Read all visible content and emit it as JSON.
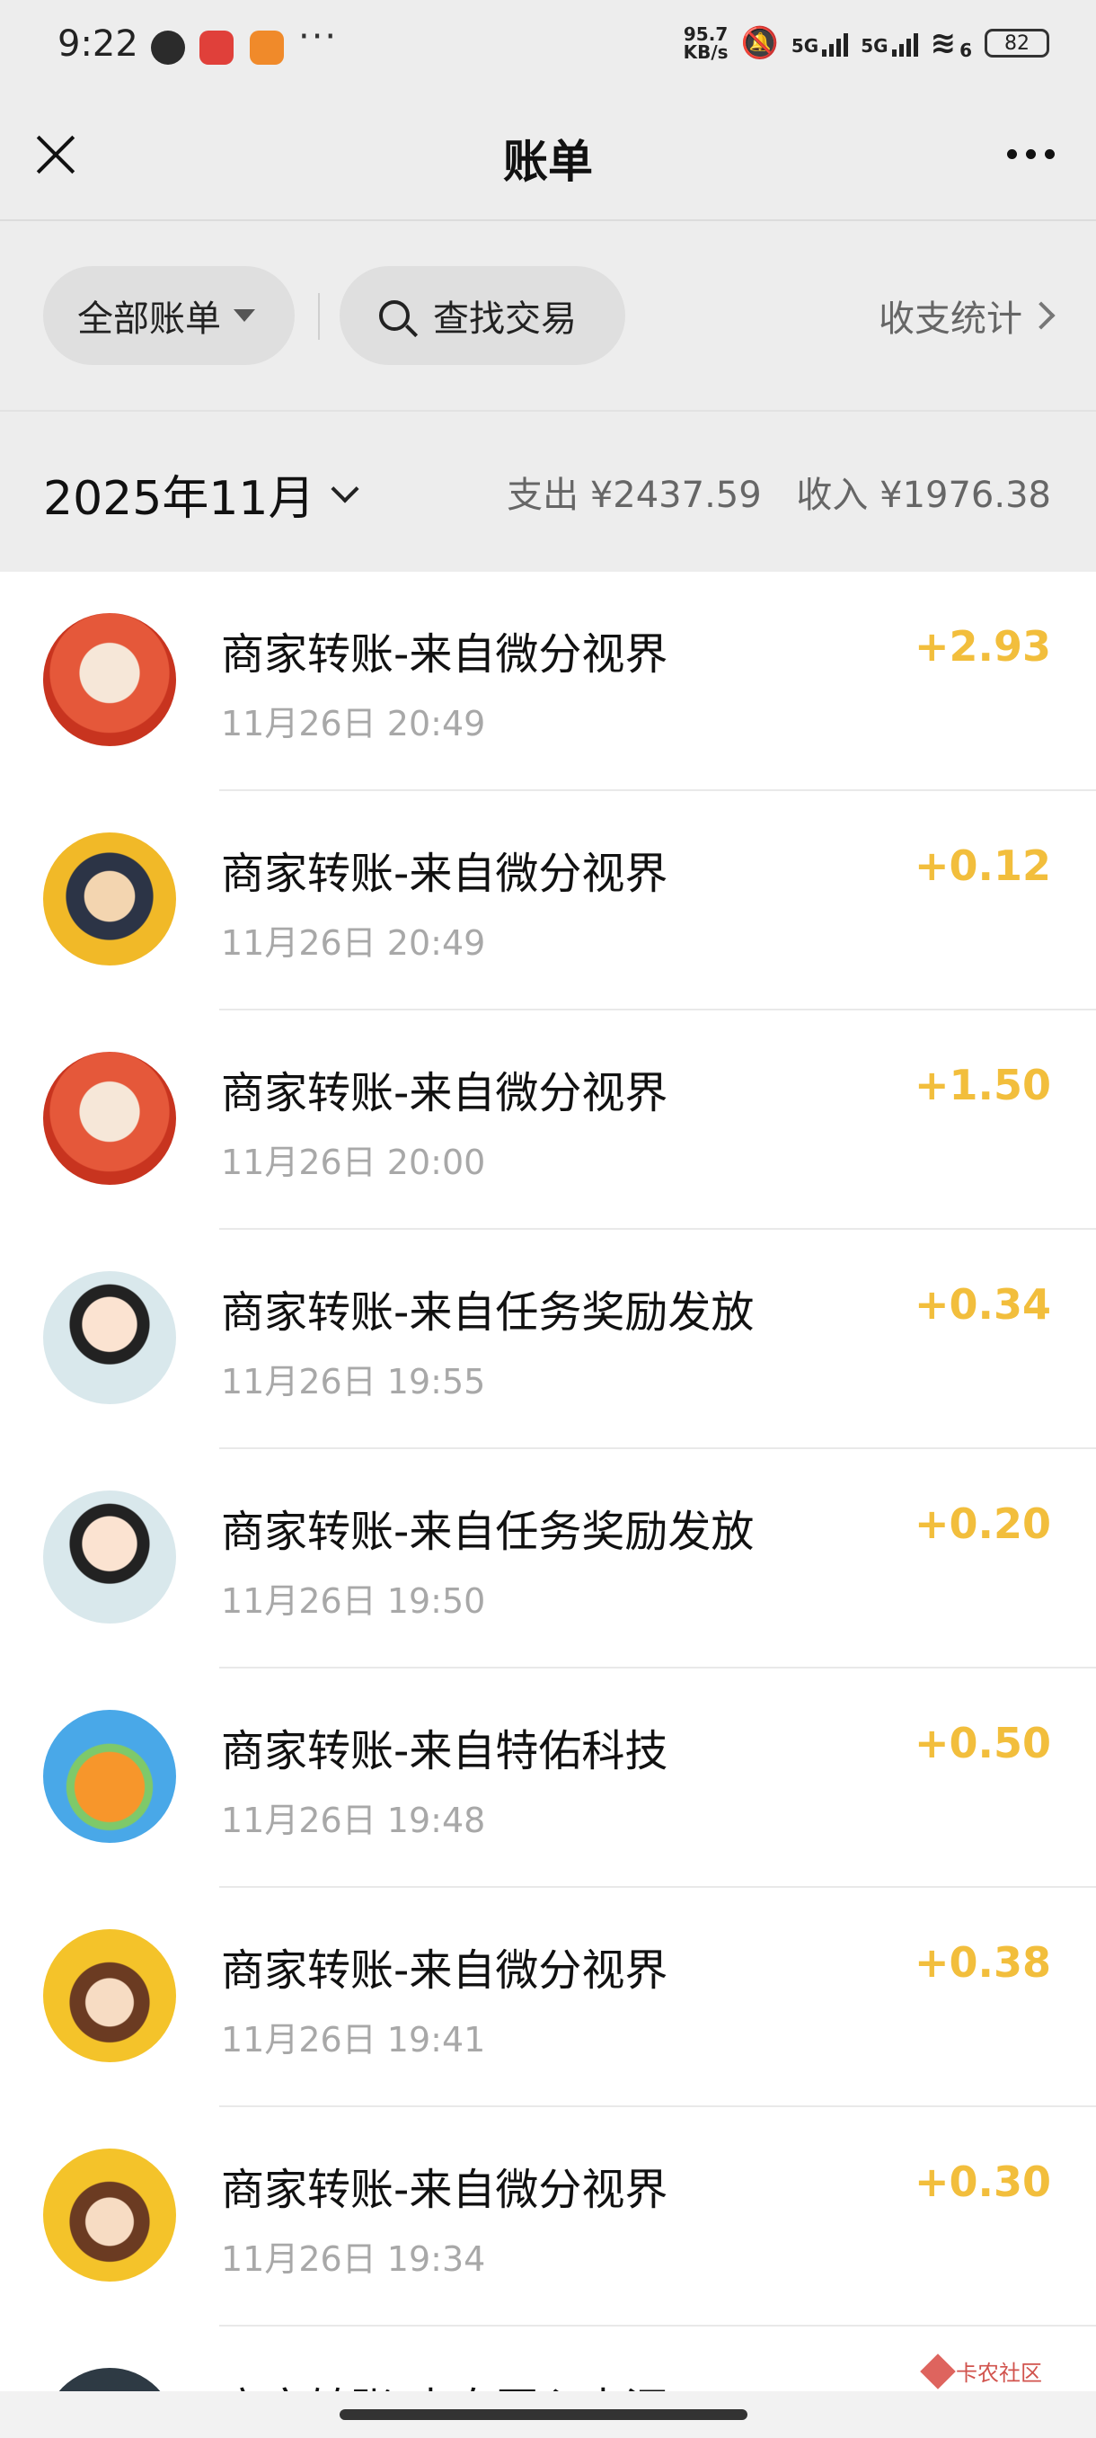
{
  "status_bar": {
    "time": "9:22",
    "more": "···",
    "net_speed_value": "95.7",
    "net_speed_unit": "KB/s",
    "sim1": "5G",
    "sim2": "5G",
    "wifi_sub": "6",
    "battery": "82"
  },
  "header": {
    "title": "账单"
  },
  "filters": {
    "all_bills": "全部账单",
    "search": "查找交易",
    "stats": "收支统计"
  },
  "month": {
    "label": "2025年11月",
    "expense": "支出 ¥2437.59",
    "income": "收入 ¥1976.38"
  },
  "transactions": [
    {
      "title": "商家转账-来自微分视界",
      "time": "11月26日 20:49",
      "amount": "+2.93"
    },
    {
      "title": "商家转账-来自微分视界",
      "time": "11月26日 20:49",
      "amount": "+0.12"
    },
    {
      "title": "商家转账-来自微分视界",
      "time": "11月26日 20:00",
      "amount": "+1.50"
    },
    {
      "title": "商家转账-来自任务奖励发放",
      "time": "11月26日 19:55",
      "amount": "+0.34"
    },
    {
      "title": "商家转账-来自任务奖励发放",
      "time": "11月26日 19:50",
      "amount": "+0.20"
    },
    {
      "title": "商家转账-来自特佑科技",
      "time": "11月26日 19:48",
      "amount": "+0.50"
    },
    {
      "title": "商家转账-来自微分视界",
      "time": "11月26日 19:41",
      "amount": "+0.38"
    },
    {
      "title": "商家转账-来自微分视界",
      "time": "11月26日 19:34",
      "amount": "+0.30"
    },
    {
      "title": "商家转账-来自匠心来汇",
      "time": "",
      "amount": ""
    }
  ],
  "watermark": "卡农社区",
  "colors": {
    "background": "#ededed",
    "list_background": "#ffffff",
    "amount_income": "#f2be3c",
    "secondary_text": "#a8a8a8"
  }
}
